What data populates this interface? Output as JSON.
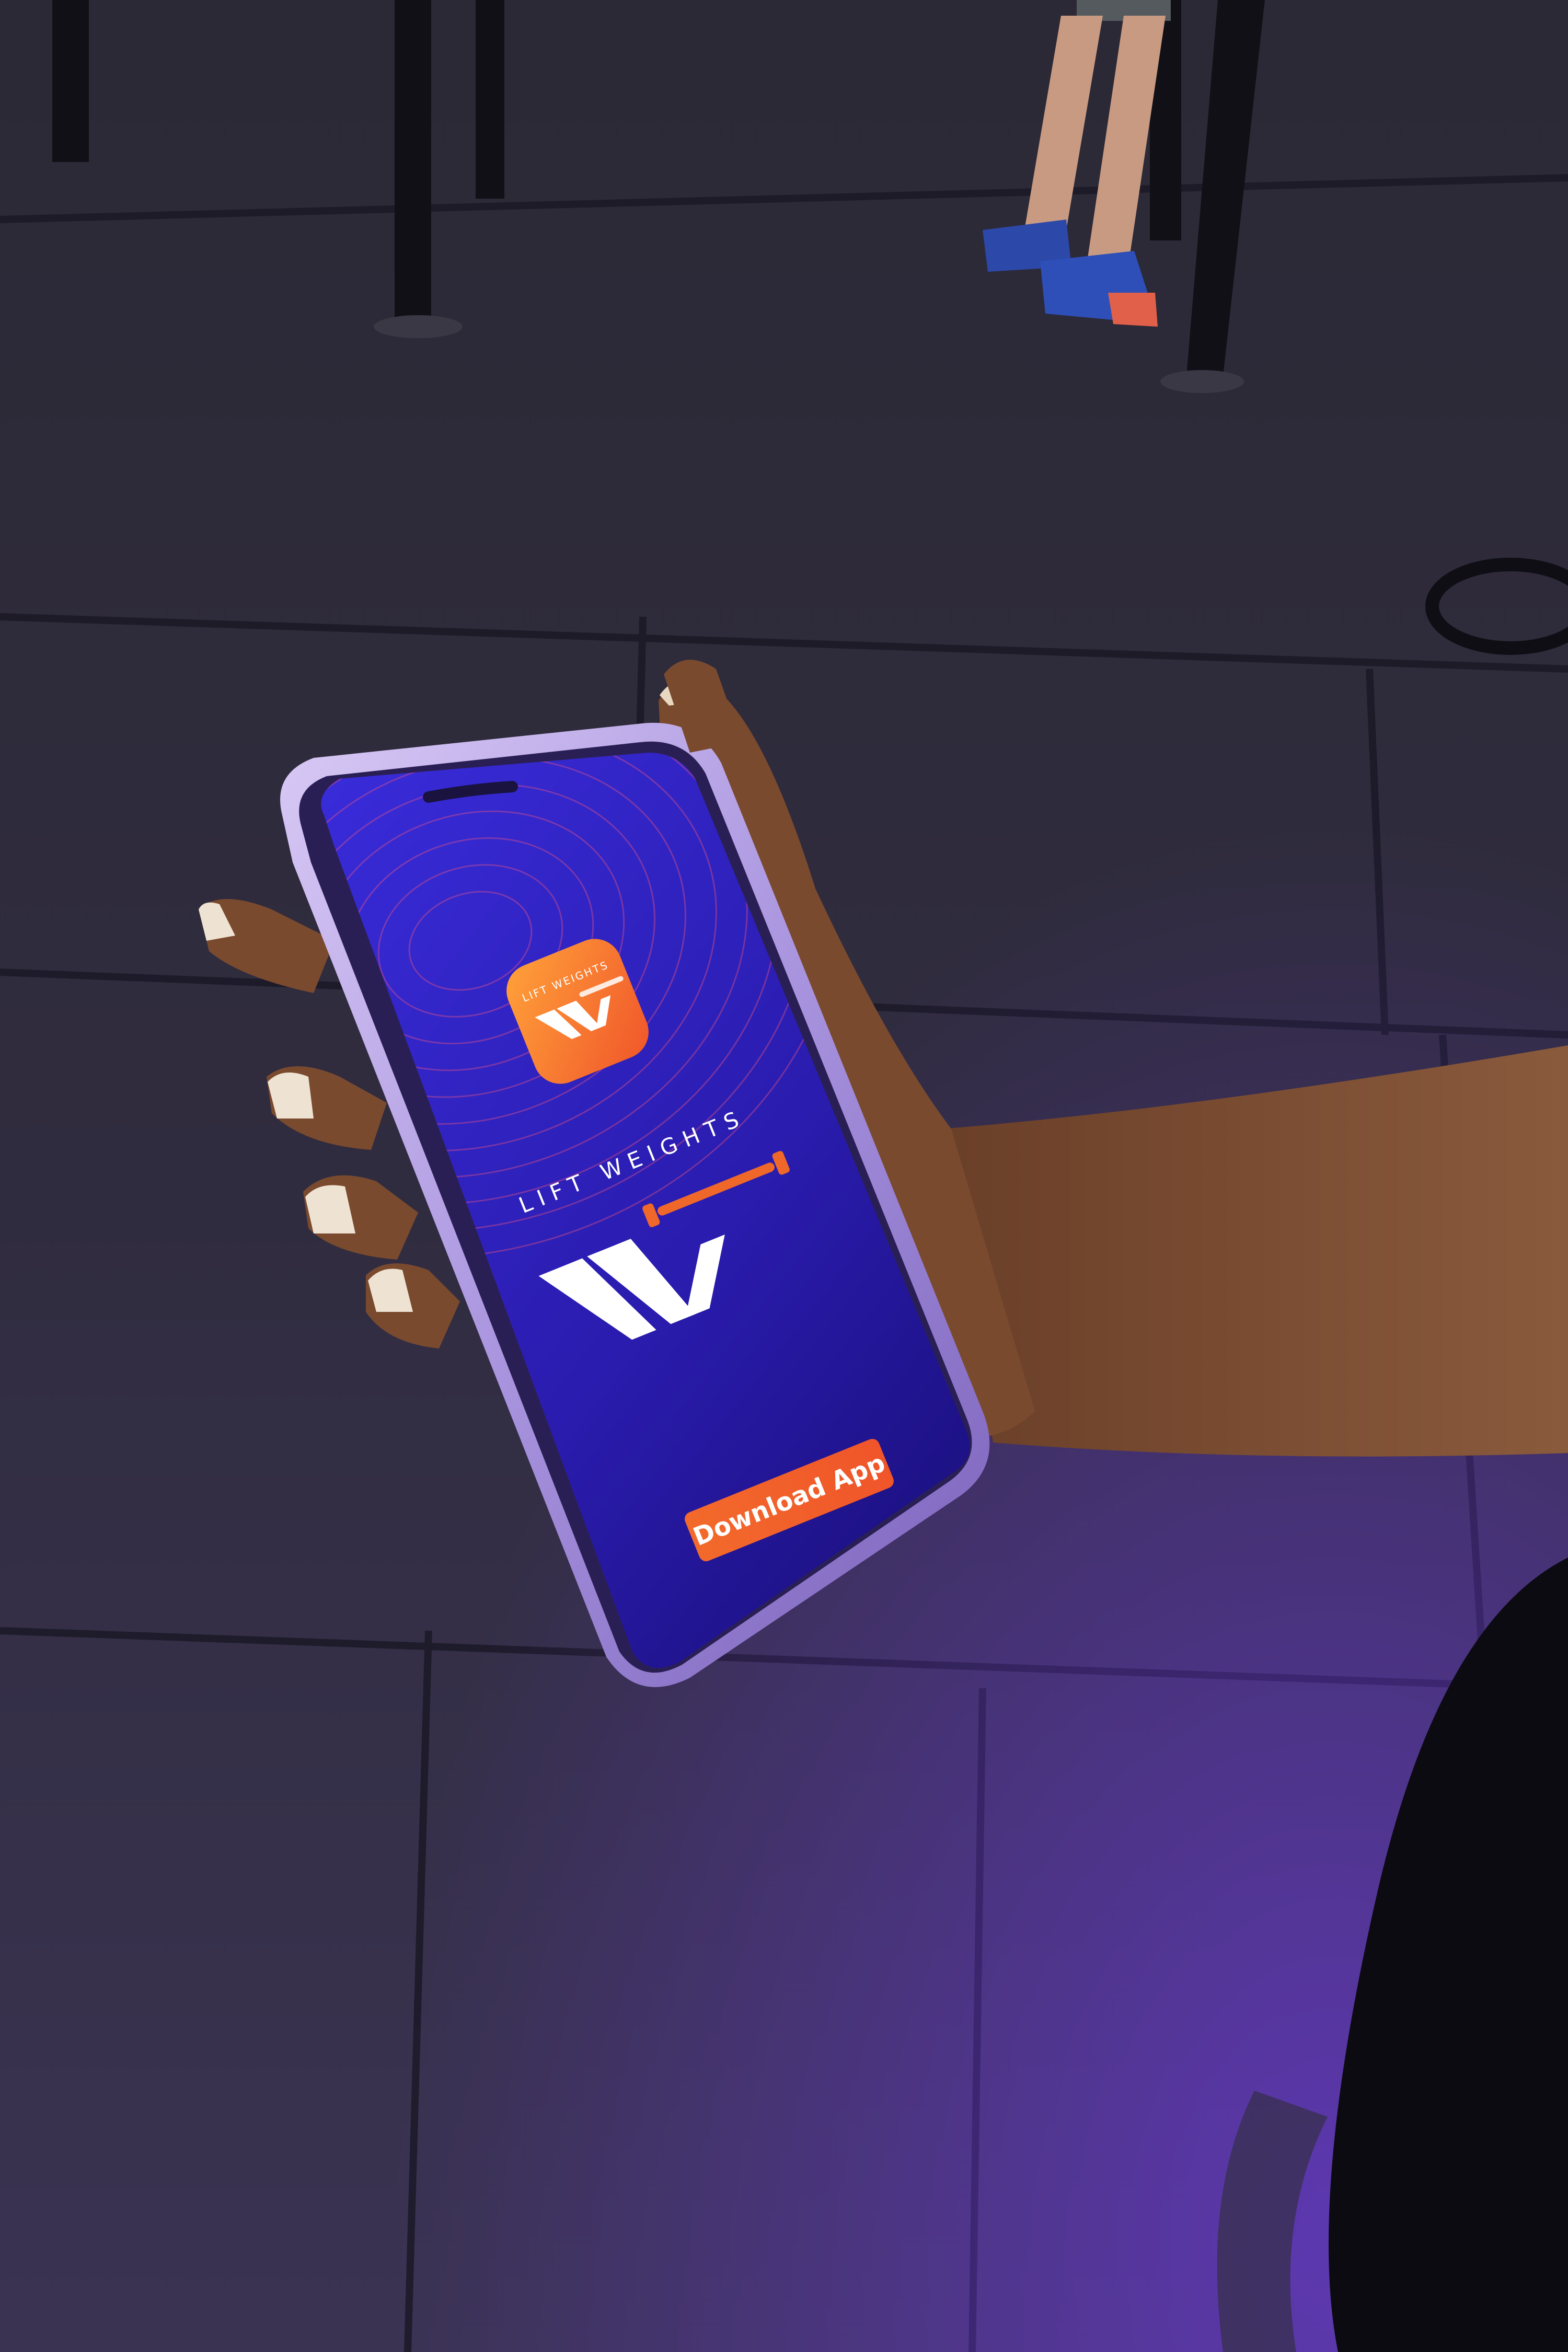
{
  "scene": {
    "description_tag": "photo",
    "colors": {
      "floor": "#2a2737",
      "floor_seam": "#1c1a27",
      "phone_case": "#b9a6e4",
      "phone_case_dark": "#6e58a8",
      "screen_top": "#3a2ad6",
      "screen_bottom": "#1a0f78",
      "accent_orange": "#f0672a",
      "accent_orange_light": "#ff9a3d",
      "skin": "#7a4a2f",
      "nail": "#efe6dc",
      "pole": "#111016"
    }
  },
  "app": {
    "icon_name": "lift-weights-app-icon",
    "icon_text": "LIFT WEIGHTS",
    "brand_text": "LIFT WEIGHTS",
    "logo_name": "lw-logo-icon",
    "download_label": "Download App"
  }
}
